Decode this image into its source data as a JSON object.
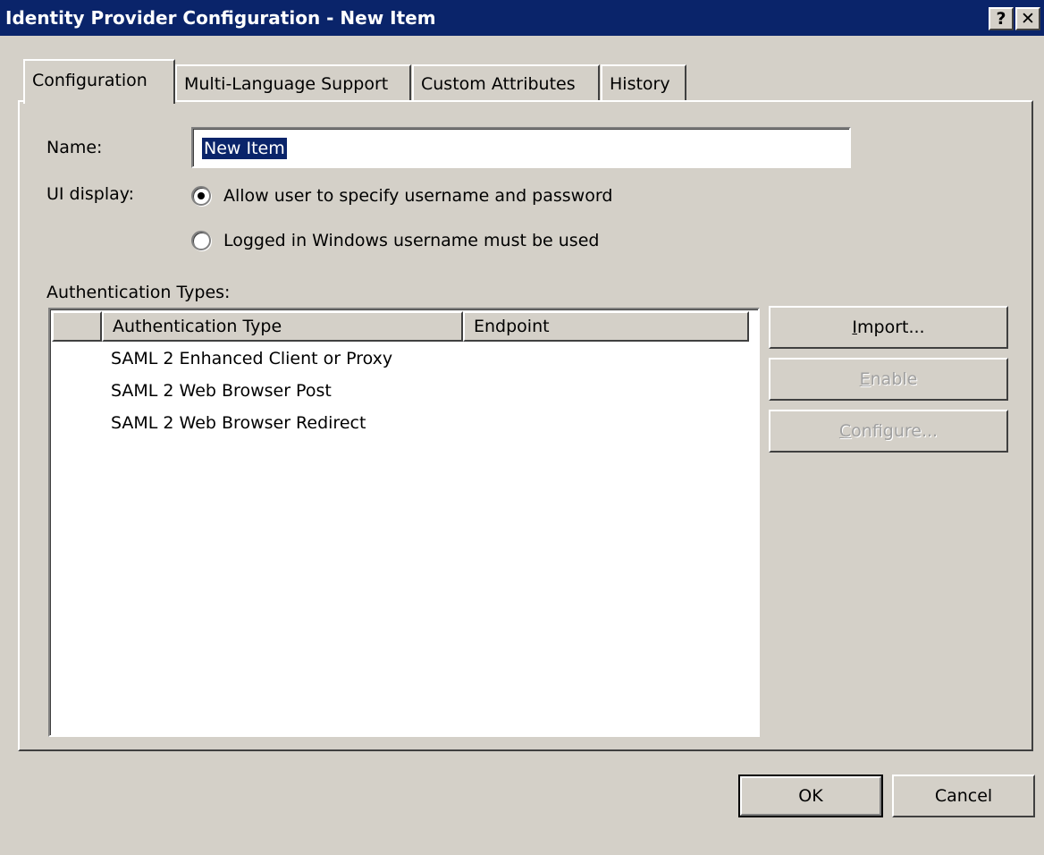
{
  "window": {
    "title": "Identity Provider Configuration - New Item",
    "help_button": "?",
    "close_button": "✕"
  },
  "tabs": [
    {
      "label": "Configuration",
      "active": true
    },
    {
      "label": "Multi-Language Support",
      "active": false
    },
    {
      "label": "Custom Attributes",
      "active": false
    },
    {
      "label": "History",
      "active": false
    }
  ],
  "form": {
    "name_label": "Name:",
    "name_value": "New Item",
    "ui_display_label": "UI display:",
    "ui_options": [
      {
        "label": "Allow user to specify username and password",
        "selected": true
      },
      {
        "label": "Logged in Windows username must be used",
        "selected": false
      }
    ],
    "auth_types_label": "Authentication Types:"
  },
  "auth_list": {
    "columns": [
      "",
      "Authentication Type",
      "Endpoint"
    ],
    "rows": [
      {
        "type": "SAML 2 Enhanced Client or Proxy",
        "endpoint": ""
      },
      {
        "type": "SAML 2 Web Browser Post",
        "endpoint": ""
      },
      {
        "type": "SAML 2 Web Browser Redirect",
        "endpoint": ""
      }
    ]
  },
  "side_buttons": {
    "import": {
      "mnemonic": "I",
      "rest": "mport...",
      "enabled": true
    },
    "enable": {
      "mnemonic": "E",
      "rest": "nable",
      "enabled": false
    },
    "configure": {
      "mnemonic": "C",
      "rest": "onfigure...",
      "enabled": false
    }
  },
  "footer": {
    "ok_label": "OK",
    "cancel_label": "Cancel"
  },
  "colors": {
    "titlebar": "#0a246a",
    "face": "#d4d0c8",
    "selection": "#0a246a"
  }
}
